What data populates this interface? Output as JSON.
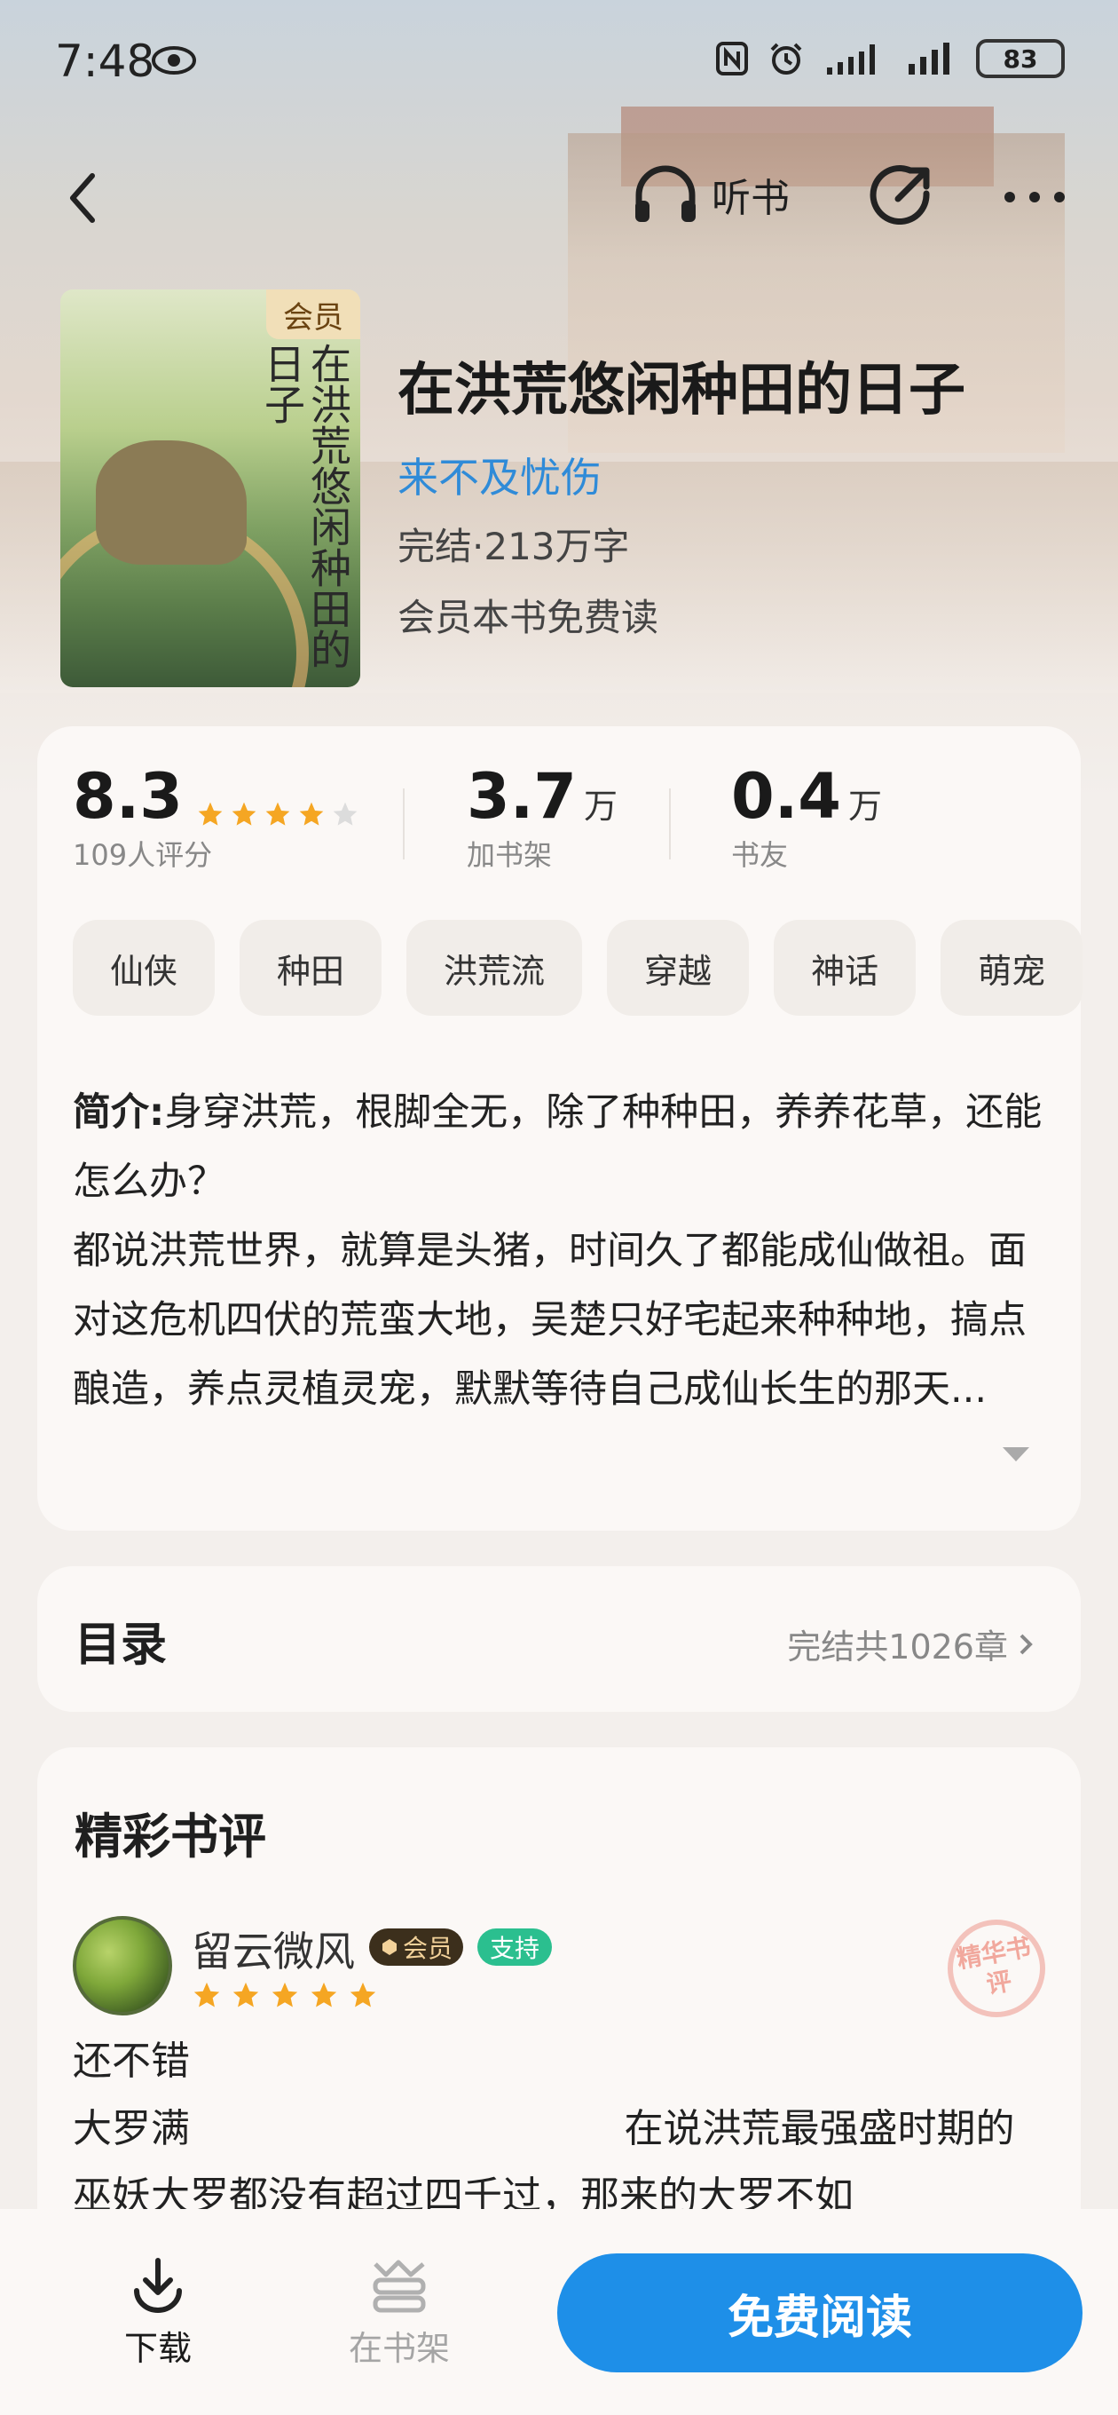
{
  "status_bar": {
    "time": "7:48",
    "battery": "83"
  },
  "nav": {
    "listen_label": "听书"
  },
  "book": {
    "cover_title": "在洪荒悠闲种田的日子",
    "vip_badge": "会员",
    "title": "在洪荒悠闲种田的日子",
    "author": "来不及忧伤",
    "status": "完结·213万字",
    "vip_note": "会员本书免费读"
  },
  "stats": {
    "rating": "8.3",
    "rating_count": "109人评分",
    "rating_stars": 4,
    "shelf_num": "3.7",
    "shelf_unit": "万",
    "shelf_label": "加书架",
    "friends_num": "0.4",
    "friends_unit": "万",
    "friends_label": "书友"
  },
  "tags": [
    "仙侠",
    "种田",
    "洪荒流",
    "穿越",
    "神话",
    "萌宠"
  ],
  "intro": {
    "label": "简介:",
    "line1": "身穿洪荒，根脚全无，除了种种田，养养花草，还能怎么办？",
    "line2": "都说洪荒世界，就算是头猪，时间久了都能成仙做祖。面对这危机四伏的荒蛮大地，吴楚只好宅起来种种地，搞点酿造，养点灵植灵宠，默默等待自己成仙长生的那天..."
  },
  "toc": {
    "title": "目录",
    "summary": "完结共1026章"
  },
  "reviews": {
    "title": "精彩书评",
    "items": [
      {
        "name": "留云微风",
        "vip": "会员",
        "support": "支持",
        "stars": 5,
        "stamp": "精华书评",
        "text_line1": "还不错",
        "text_line2": "大罗满                                   在说洪荒最强盛时期的巫妖大罗都没有超过四千过，那来的大罗不如"
      }
    ]
  },
  "bottom_bar": {
    "download": "下载",
    "in_shelf": "在书架",
    "read": "免费阅读"
  },
  "colors": {
    "accent_blue": "#1e8fe8",
    "author_blue": "#2f8bd8",
    "star_gold": "#f5a623",
    "support_green": "#2bbf8f"
  }
}
